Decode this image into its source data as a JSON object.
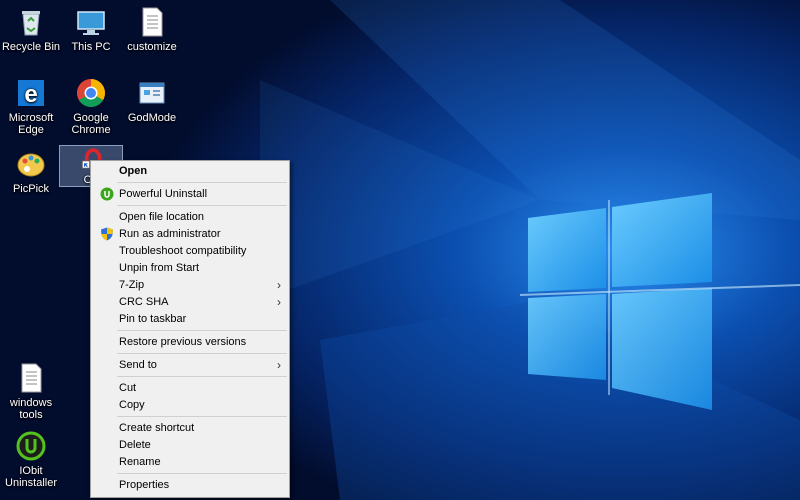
{
  "desktop": {
    "icons": [
      {
        "label": "Recycle Bin",
        "icon": "recycle-bin-icon"
      },
      {
        "label": "This PC",
        "icon": "this-pc-icon"
      },
      {
        "label": "customize",
        "icon": "text-file-icon"
      },
      {
        "label": "Microsoft Edge",
        "icon": "edge-icon"
      },
      {
        "label": "Google Chrome",
        "icon": "chrome-icon"
      },
      {
        "label": "GodMode",
        "icon": "godmode-icon"
      },
      {
        "label": "PicPick",
        "icon": "picpick-icon"
      },
      {
        "label": "Op",
        "icon": "opera-icon"
      },
      {
        "label": "windows tools",
        "icon": "text-file-icon"
      },
      {
        "label": "IObit Uninstaller",
        "icon": "iobit-icon"
      }
    ]
  },
  "context_menu": {
    "items": [
      {
        "label": "Open",
        "bold": true
      },
      {
        "label": "Powerful Uninstall",
        "icon": "iobit-uninstall-icon"
      },
      {
        "label": "Open file location"
      },
      {
        "label": "Run as administrator",
        "icon": "uac-shield-icon"
      },
      {
        "label": "Troubleshoot compatibility"
      },
      {
        "label": "Unpin from Start"
      },
      {
        "label": "7-Zip",
        "submenu": true
      },
      {
        "label": "CRC SHA",
        "submenu": true
      },
      {
        "label": "Pin to taskbar"
      },
      {
        "label": "Restore previous versions"
      },
      {
        "label": "Send to",
        "submenu": true
      },
      {
        "label": "Cut"
      },
      {
        "label": "Copy"
      },
      {
        "label": "Create shortcut"
      },
      {
        "label": "Delete"
      },
      {
        "label": "Rename"
      },
      {
        "label": "Properties"
      }
    ]
  },
  "colors": {
    "wallpaper_dark": "#03133a",
    "wallpaper_light": "#1a7be0",
    "menu_bg": "#f0f0f0"
  }
}
